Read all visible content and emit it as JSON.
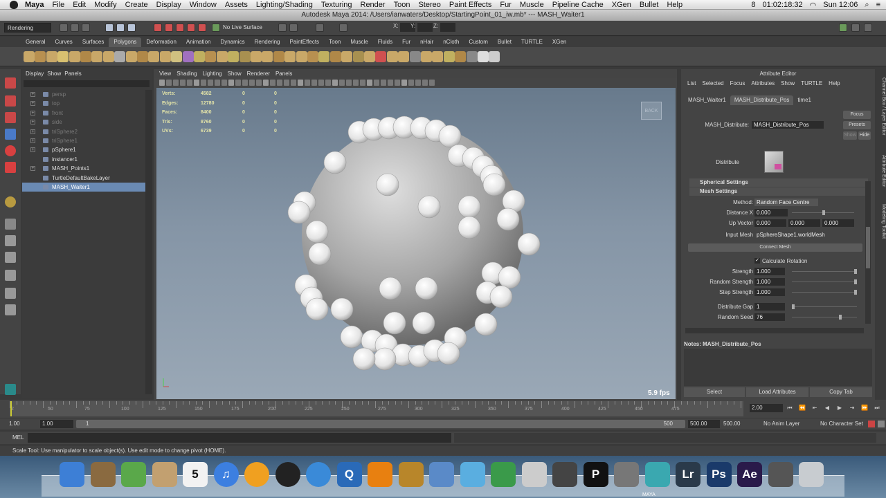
{
  "mac_menu": {
    "app": "Maya",
    "items": [
      "File",
      "Edit",
      "Modify",
      "Create",
      "Display",
      "Window",
      "Assets",
      "Lighting/Shading",
      "Texturing",
      "Render",
      "Toon",
      "Stereo",
      "Paint Effects",
      "Fur",
      "Muscle",
      "Pipeline Cache",
      "XGen",
      "Bullet",
      "Help"
    ],
    "status": {
      "time_elapsed": "01:02:18:32",
      "clock": "Sun 12:06",
      "badge_count": "8"
    }
  },
  "window_title": "Autodesk Maya 2014: /Users/ianwaters/Desktop/StartingPoint_01_iw.mb*  ---  MASH_Waiter1",
  "status_line": {
    "mode": "Rendering",
    "live_surface": "No Live Surface",
    "x_label": "X:",
    "y_label": "Y:",
    "z_label": "Z:"
  },
  "shelf_tabs": [
    {
      "label": "General"
    },
    {
      "label": "Curves"
    },
    {
      "label": "Surfaces"
    },
    {
      "label": "Polygons",
      "active": true
    },
    {
      "label": "Deformation"
    },
    {
      "label": "Animation"
    },
    {
      "label": "Dynamics"
    },
    {
      "label": "Rendering"
    },
    {
      "label": "PaintEffects"
    },
    {
      "label": "Toon"
    },
    {
      "label": "Muscle"
    },
    {
      "label": "Fluids"
    },
    {
      "label": "Fur"
    },
    {
      "label": "nHair"
    },
    {
      "label": "nCloth"
    },
    {
      "label": "Custom"
    },
    {
      "label": "Bullet"
    },
    {
      "label": "TURTLE"
    },
    {
      "label": "XGen"
    }
  ],
  "outliner": {
    "menu": [
      "Display",
      "Show",
      "Panels"
    ],
    "items": [
      {
        "label": "persp",
        "dim": true,
        "expand": true
      },
      {
        "label": "top",
        "dim": true,
        "expand": true
      },
      {
        "label": "front",
        "dim": true,
        "expand": true
      },
      {
        "label": "side",
        "dim": true,
        "expand": true
      },
      {
        "label": "triSphere2",
        "dim": true,
        "expand": true
      },
      {
        "label": "triSphere1",
        "dim": true,
        "expand": true
      },
      {
        "label": "pSphere1",
        "expand": true
      },
      {
        "label": "instancer1"
      },
      {
        "label": "MASH_Points1",
        "expand": true
      },
      {
        "label": "TurtleDefaultBakeLayer"
      },
      {
        "label": "MASH_Waiter1",
        "selected": true
      }
    ]
  },
  "viewport": {
    "menu": [
      "View",
      "Shading",
      "Lighting",
      "Show",
      "Renderer",
      "Panels"
    ],
    "hud": [
      {
        "label": "Verts:",
        "v1": "4582",
        "v2": "0",
        "v3": "0"
      },
      {
        "label": "Edges:",
        "v1": "12780",
        "v2": "0",
        "v3": "0"
      },
      {
        "label": "Faces:",
        "v1": "8400",
        "v2": "0",
        "v3": "0"
      },
      {
        "label": "Tris:",
        "v1": "8760",
        "v2": "0",
        "v3": "0"
      },
      {
        "label": "UVs:",
        "v1": "6739",
        "v2": "0",
        "v3": "0"
      }
    ],
    "view_cube": "BACK",
    "fps": "5.9 fps"
  },
  "attribute_editor": {
    "title": "Attribute Editor",
    "menu": [
      "List",
      "Selected",
      "Focus",
      "Attributes",
      "Show",
      "TURTLE",
      "Help"
    ],
    "tabs": [
      {
        "label": "MASH_Waiter1"
      },
      {
        "label": "MASH_Distribute_Pos",
        "active": true
      },
      {
        "label": "time1"
      }
    ],
    "node_label": "MASH_Distribute:",
    "node_value": "MASH_Distribute_Pos",
    "focus": "Focus",
    "presets": "Presets",
    "show": "Show",
    "hide": "Hide",
    "distribute_label": "Distribute",
    "spherical_settings": "Spherical Settings",
    "mesh_settings": "Mesh Settings",
    "method_label": "Method:",
    "method_value": "Random Face Centre",
    "distance_x_label": "Distance X",
    "distance_x": "0.000",
    "up_vector_label": "Up Vector",
    "up_vector": [
      "0.000",
      "0.000",
      "0.000"
    ],
    "input_mesh_label": "Input Mesh",
    "input_mesh": "pSphereShape1.worldMesh",
    "connect_mesh": "Connect Mesh",
    "calc_rotation": "Calculate Rotation",
    "strength_label": "Strength",
    "strength": "1.000",
    "random_strength_label": "Random Strength",
    "random_strength": "1.000",
    "step_strength_label": "Step Strength",
    "step_strength": "1.000",
    "distribute_gap_label": "Distribute Gap",
    "distribute_gap": "1",
    "random_seed_label": "Random Seed",
    "random_seed": "76",
    "notes_label": "Notes:",
    "notes_node": "MASH_Distribute_Pos",
    "buttons": {
      "select": "Select",
      "load": "Load Attributes",
      "copy": "Copy Tab"
    }
  },
  "side_tabs": [
    "Channel Box / Layer Editor",
    "Attribute Editor",
    "Modeling Toolkit"
  ],
  "timeline": {
    "ticks": [
      "2",
      "",
      "",
      "",
      "",
      "",
      "",
      "",
      "",
      "",
      "100",
      "",
      "",
      "",
      "",
      "",
      "",
      "",
      "",
      "",
      "",
      "",
      "",
      "",
      "",
      "",
      "",
      "",
      "",
      "",
      "",
      "",
      "",
      "",
      "",
      "",
      "",
      "",
      "",
      "",
      "",
      "",
      "",
      "",
      "",
      "",
      "",
      "",
      "",
      "",
      "",
      "",
      "500"
    ],
    "tick_labels": [
      {
        "t": "2",
        "x": 0
      },
      {
        "t": "50",
        "x": 1
      },
      {
        "t": "75",
        "x": 2
      },
      {
        "t": "100",
        "x": 3
      },
      {
        "t": "125",
        "x": 4
      },
      {
        "t": "150",
        "x": 5
      },
      {
        "t": "175",
        "x": 6
      },
      {
        "t": "200",
        "x": 7
      },
      {
        "t": "225",
        "x": 8
      },
      {
        "t": "250",
        "x": 9
      },
      {
        "t": "275",
        "x": 10
      },
      {
        "t": "300",
        "x": 11
      },
      {
        "t": "325",
        "x": 12
      },
      {
        "t": "350",
        "x": 13
      },
      {
        "t": "375",
        "x": 14
      },
      {
        "t": "400",
        "x": 15
      },
      {
        "t": "425",
        "x": 16
      },
      {
        "t": "450",
        "x": 17
      },
      {
        "t": "475",
        "x": 18
      }
    ],
    "current_frame": "2.00"
  },
  "range": {
    "start": "1.00",
    "inner_start": "1.00",
    "inner_tick": "1",
    "inner_end": "500",
    "end_a": "500.00",
    "end_b": "500.00",
    "anim_layer": "No Anim Layer",
    "char_set": "No Character Set"
  },
  "mel_label": "MEL",
  "help_line": "Scale Tool: Use manipulator to scale object(s). Use edit mode to change pivot (HOME).",
  "dock": [
    {
      "name": "finder-icon",
      "color": "#3d7fd6",
      "glyph": ""
    },
    {
      "name": "preview-icon",
      "color": "#8a6a40",
      "glyph": ""
    },
    {
      "name": "evernote-icon",
      "color": "#5aa84a",
      "glyph": ""
    },
    {
      "name": "photos-icon",
      "color": "#c2a070",
      "glyph": ""
    },
    {
      "name": "calendar-icon",
      "color": "#f2f2f2",
      "glyph": "5"
    },
    {
      "name": "itunes-icon",
      "color": "#3c7fe0",
      "glyph": "♫"
    },
    {
      "name": "ibooks-icon",
      "color": "#f0a020",
      "glyph": ""
    },
    {
      "name": "spotify-icon",
      "color": "#222",
      "glyph": ""
    },
    {
      "name": "safari-icon",
      "color": "#3a8ad8",
      "glyph": ""
    },
    {
      "name": "quicktime-icon",
      "color": "#2a6ab8",
      "glyph": "Q"
    },
    {
      "name": "vlc-icon",
      "color": "#e88010",
      "glyph": ""
    },
    {
      "name": "script-icon",
      "color": "#b8862a",
      "glyph": ""
    },
    {
      "name": "xcode-icon",
      "color": "#5a8ac8",
      "glyph": ""
    },
    {
      "name": "cube-icon",
      "color": "#5aaee0",
      "glyph": ""
    },
    {
      "name": "triangle-icon",
      "color": "#3a9a4a",
      "glyph": ""
    },
    {
      "name": "bar-icon",
      "color": "#cccccc",
      "glyph": ""
    },
    {
      "name": "clapper-icon",
      "color": "#444",
      "glyph": ""
    },
    {
      "name": "p-app-icon",
      "color": "#111",
      "glyph": "P"
    },
    {
      "name": "inkscape-icon",
      "color": "#777",
      "glyph": ""
    },
    {
      "name": "maya-icon",
      "color": "#3aa8b0",
      "glyph": ""
    },
    {
      "name": "lightroom-icon",
      "color": "#2a3a4a",
      "glyph": "Lr"
    },
    {
      "name": "photoshop-icon",
      "color": "#1a3a6a",
      "glyph": "Ps"
    },
    {
      "name": "aftereffects-icon",
      "color": "#2a1a4a",
      "glyph": "Ae"
    },
    {
      "name": "movie-icon",
      "color": "#555",
      "glyph": ""
    },
    {
      "name": "trash-icon",
      "color": "#c8ccd0",
      "glyph": ""
    }
  ],
  "dock_maya_label": "MAYA"
}
